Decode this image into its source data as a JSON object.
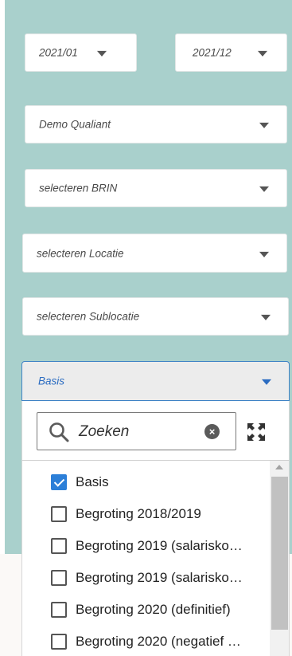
{
  "filters": {
    "period_from": "2021/01",
    "period_to": "2021/12",
    "organisation": "Demo Qualiant",
    "brin_placeholder": "selecteren BRIN",
    "location_placeholder": "selecteren Locatie",
    "sublocation_placeholder": "selecteren Sublocatie",
    "scenario_selected": "Basis"
  },
  "dropdown": {
    "search_placeholder": "Zoeken",
    "options": [
      {
        "label": "Basis",
        "checked": true
      },
      {
        "label": "Begroting 2018/2019",
        "checked": false
      },
      {
        "label": "Begroting 2019 (salarisko…",
        "checked": false
      },
      {
        "label": "Begroting 2019 (salarisko…",
        "checked": false
      },
      {
        "label": "Begroting 2020 (definitief)",
        "checked": false
      },
      {
        "label": "Begroting 2020 (negatief …",
        "checked": false
      }
    ]
  },
  "colors": {
    "panel_bg": "#a9d0cc",
    "accent": "#2c7fd8",
    "focus_border": "#3f83c5"
  },
  "icons": [
    "chevron-down-icon",
    "search-icon",
    "clear-icon",
    "expand-icon",
    "checkbox-icon",
    "scroll-up-icon"
  ]
}
